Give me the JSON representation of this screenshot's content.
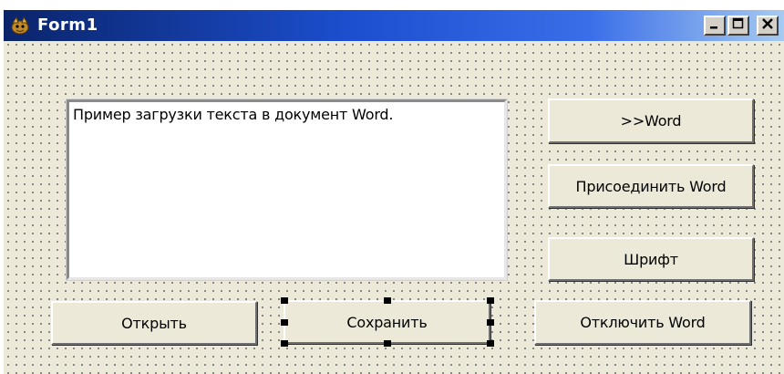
{
  "window": {
    "title": "Form1",
    "icon": "delphi-form-icon",
    "caption_buttons": {
      "minimize": "minimize-icon",
      "maximize": "maximize-icon",
      "close": "close-icon"
    }
  },
  "memo": {
    "text": "Пример загрузки текста в документ Word."
  },
  "buttons": {
    "to_word": ">>Word",
    "connect_word": "Присоединить Word",
    "font": "Шрифт",
    "disconnect_word": "Отключить Word",
    "open": "Открыть",
    "save": "Сохранить"
  },
  "colors": {
    "form_background": "#ece9d8",
    "titlebar_start": "#0a246a",
    "titlebar_end": "#a6caf0",
    "grid_dot": "#6d6d6d"
  }
}
